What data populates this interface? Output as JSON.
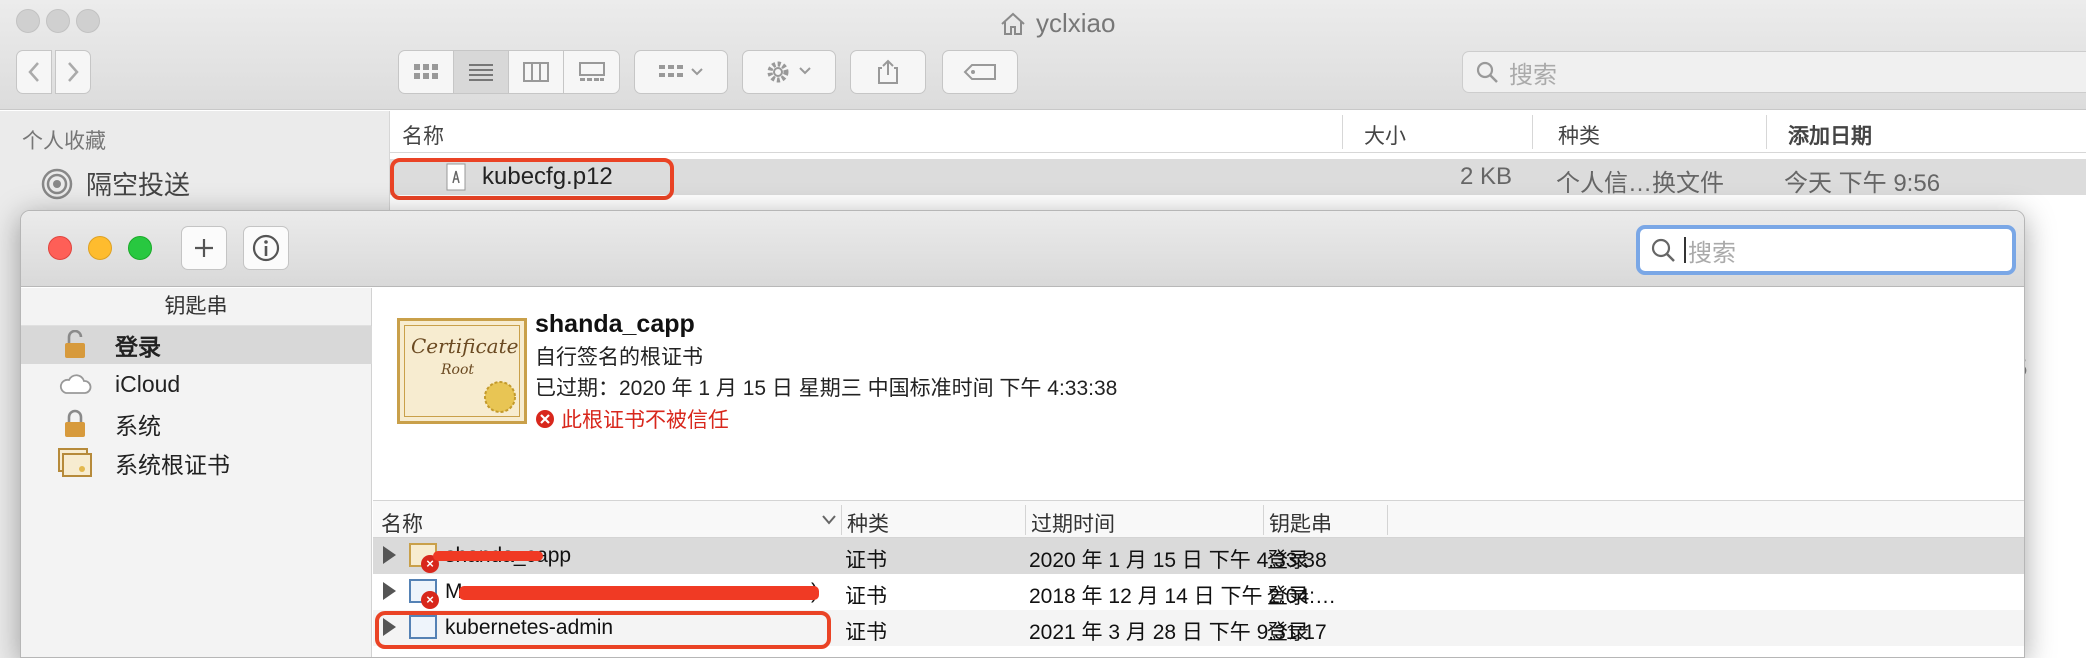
{
  "finder": {
    "title": "yclxiao",
    "search_placeholder": "搜索",
    "sidebar": {
      "heading": "个人收藏",
      "items": [
        {
          "label": "隔空投送"
        }
      ]
    },
    "columns": {
      "name": "名称",
      "size": "大小",
      "kind": "种类",
      "date_added": "添加日期"
    },
    "rows": [
      {
        "name": "kubecfg.p12",
        "size": "2 KB",
        "kind": "个人信…换文件",
        "date": "今天 下午 9:56"
      }
    ],
    "edge_digit": "5"
  },
  "keychain": {
    "search_placeholder": "搜索",
    "sidebar": {
      "heading": "钥匙串",
      "items": [
        {
          "label": "登录",
          "icon": "padlock-open-icon"
        },
        {
          "label": "iCloud",
          "icon": "cloud-icon"
        },
        {
          "label": "系统",
          "icon": "padlock-icon"
        },
        {
          "label": "系统根证书",
          "icon": "certificate-cabinet-icon"
        }
      ]
    },
    "detail": {
      "name": "shanda_capp",
      "subtitle": "自行签名的根证书",
      "expiry": "已过期：2020 年 1 月 15 日 星期三 中国标准时间 下午 4:33:38",
      "warning": "此根证书不被信任",
      "image_text_1": "Certificate",
      "image_text_2": "Root"
    },
    "table": {
      "columns": {
        "name": "名称",
        "kind": "种类",
        "expires": "过期时间",
        "keychain": "钥匙串"
      },
      "rows": [
        {
          "name": "shanda_capp",
          "kind": "证书",
          "expires": "2020 年 1 月 15 日 下午 4:33:38",
          "keychain": "登录"
        },
        {
          "name": "Mac",
          "name_tail": ")",
          "kind": "证书",
          "expires": "2018 年 12 月 14 日 下午 2:04:…",
          "keychain": "登录"
        },
        {
          "name": "kubernetes-admin",
          "kind": "证书",
          "expires": "2021 年 3 月 28 日 下午 9:31:17",
          "keychain": "登录"
        }
      ]
    }
  },
  "colors": {
    "highlight": "#ea4325",
    "warning": "#d8271c",
    "search_focus": "#7aa7e6"
  }
}
